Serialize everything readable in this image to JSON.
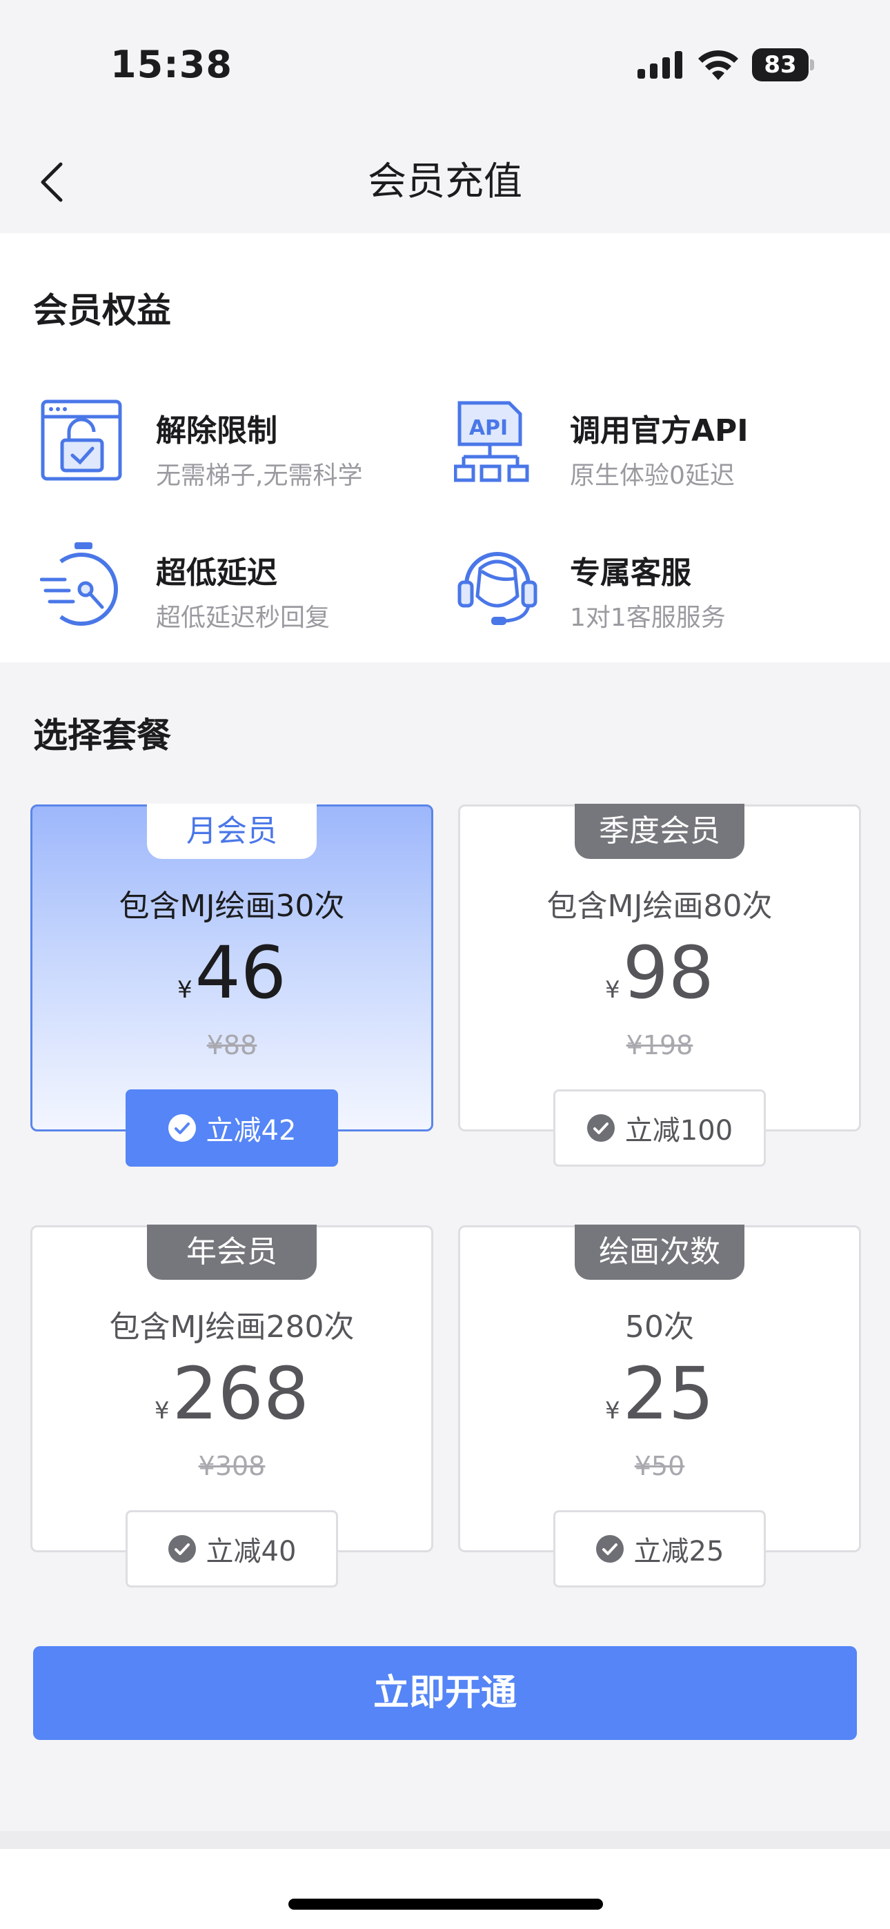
{
  "status_bar": {
    "time": "15:38",
    "battery": "83"
  },
  "nav": {
    "title": "会员充值"
  },
  "benefits": {
    "title": "会员权益",
    "items": [
      {
        "icon": "unlock-icon",
        "title": "解除限制",
        "desc": "无需梯子,无需科学"
      },
      {
        "icon": "api-icon",
        "title": "调用官方API",
        "desc": "原生体验0延迟"
      },
      {
        "icon": "stopwatch-icon",
        "title": "超低延迟",
        "desc": "超低延迟秒回复"
      },
      {
        "icon": "headset-icon",
        "title": "专属客服",
        "desc": "1对1客服服务"
      }
    ]
  },
  "plans": {
    "title": "选择套餐",
    "currency": "¥",
    "items": [
      {
        "tag": "月会员",
        "desc": "包含MJ绘画30次",
        "price": "46",
        "original": "¥88",
        "discount": "立减42",
        "selected": true
      },
      {
        "tag": "季度会员",
        "desc": "包含MJ绘画80次",
        "price": "98",
        "original": "¥198",
        "discount": "立减100",
        "selected": false
      },
      {
        "tag": "年会员",
        "desc": "包含MJ绘画280次",
        "price": "268",
        "original": "¥308",
        "discount": "立减40",
        "selected": false
      },
      {
        "tag": "绘画次数",
        "desc": "50次",
        "price": "25",
        "original": "¥50",
        "discount": "立减25",
        "selected": false
      }
    ]
  },
  "cta": {
    "label": "立即开通"
  },
  "colors": {
    "accent": "#5585f6",
    "selected_border": "#5a86ea",
    "icon_blue": "#4a77e8"
  }
}
